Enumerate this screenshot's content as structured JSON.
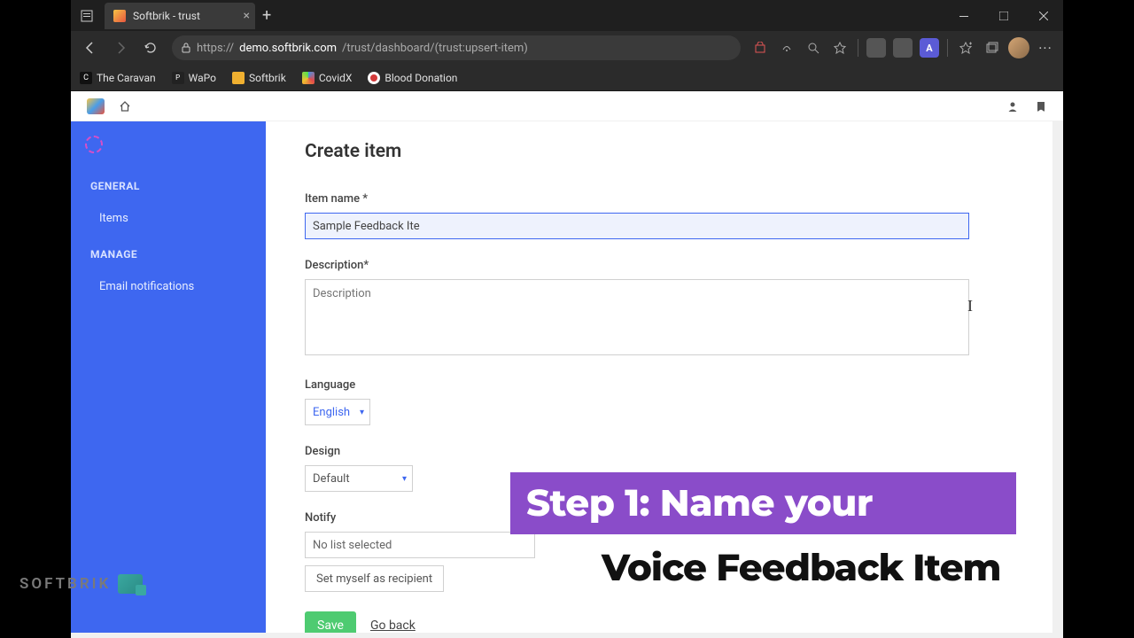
{
  "browser": {
    "tab_title": "Softbrik - trust",
    "url_prefix": "https://",
    "url_host": "demo.softbrik.com",
    "url_path": "/trust/dashboard/(trust:upsert-item)"
  },
  "bookmarks": [
    {
      "label": "The Caravan",
      "icon_bg": "#111"
    },
    {
      "label": "WaPo",
      "icon_bg": "#222"
    },
    {
      "label": "Softbrik",
      "icon_bg": "#f0b030"
    },
    {
      "label": "CovidX",
      "icon_bg": "linear"
    },
    {
      "label": "Blood Donation",
      "icon_bg": "#d43b3b"
    }
  ],
  "sidebar": {
    "section1": "GENERAL",
    "item1": "Items",
    "section2": "MANAGE",
    "item2": "Email notifications"
  },
  "page_title": "Create item",
  "form": {
    "item_name_label": "Item name *",
    "item_name_value": "Sample Feedback Ite",
    "description_label": "Description*",
    "description_placeholder": "Description",
    "language_label": "Language",
    "language_value": "English",
    "design_label": "Design",
    "design_value": "Default",
    "notify_label": "Notify",
    "notify_value": "No list selected",
    "set_myself": "Set myself as recipient",
    "save": "Save",
    "go_back": "Go back"
  },
  "overlay": {
    "line1": "Step 1: Name your",
    "line2": "Voice Feedback Item"
  },
  "watermark": "SOFTBRIK"
}
